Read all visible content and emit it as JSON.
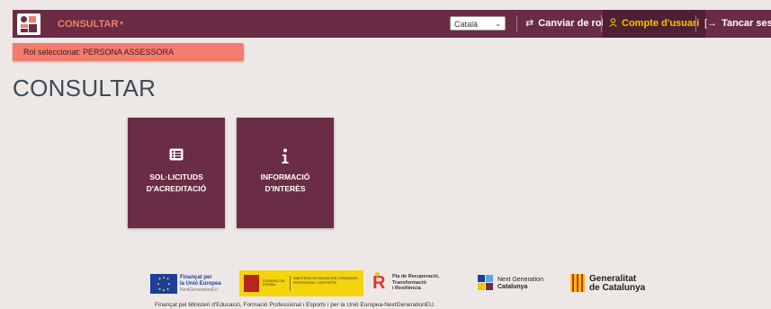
{
  "nav": {
    "consultar_label": "CONSULTAR",
    "language_selected": "Català",
    "switch_role_label": "Canviar de rol",
    "account_label": "Compte d'usuari",
    "logout_label": "Tancar sessió"
  },
  "role_banner": "Rol seleccionat: PERSONA ASSESSORA",
  "page_title": "CONSULTAR",
  "tiles": [
    {
      "line1": "SOL·LICITUDS",
      "line2": "D'ACREDITACIÓ",
      "icon": "list-icon"
    },
    {
      "line1": "INFORMACIÓ",
      "line2": "D'INTERÈS",
      "icon": "info-icon"
    }
  ],
  "footer": {
    "eu_line1": "Finançat per",
    "eu_line2": "la Unió Europea",
    "eu_line3": "NextGenerationEU",
    "ministry_text": "GOBIERNO DE ESPAÑA",
    "ministry_dept": "MINISTERIO DE EDUCACIÓN, FORMACIÓN PROFESIONAL Y DEPORTES",
    "plan_line1": "Pla de Recuperació,",
    "plan_line2": "Transformació",
    "plan_line3": "i Resiliència",
    "nextgen_line1": "Next Generation",
    "nextgen_line2": "Catalunya",
    "gencat_line1": "Generalitat",
    "gencat_line2": "de Catalunya",
    "funding_text": "Finançat pel Ministeri d'Educació, Formació Professional i Esports i per la Unió Europea-NextGenerationEU."
  },
  "colors": {
    "brand": "#6a2c44",
    "accent": "#f47c6c",
    "highlight": "#f4c400"
  }
}
